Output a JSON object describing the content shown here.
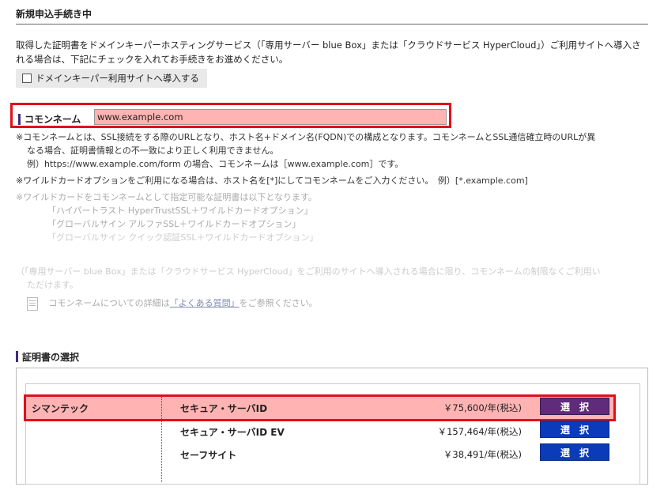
{
  "header": {
    "title": "新規申込手続き中"
  },
  "intro": {
    "text": "取得した証明書をドメインキーパーホスティングサービス（「専用サーバー blue Box」または「クラウドサービス HyperCloud」）ご利用サイトへ導入される場合は、下記にチェックを入れてお手続きをお進めください。"
  },
  "install_checkbox": {
    "label": "ドメインキーパー利用サイトへ導入する",
    "checked": false
  },
  "common_name": {
    "label": "コモンネーム",
    "value": "www.example.com"
  },
  "notes": {
    "n1_line1": "※コモンネームとは、SSL接続をする際のURLとなり、ホスト名+ドメイン名(FQDN)での構成となります。コモンネームとSSL通信確立時のURLが異",
    "n1_line2": "なる場合、証明書情報との不一致により正しく利用できません。",
    "n1_example": "例）https://www.example.com/form の場合、コモンネームは［www.example.com］です。",
    "n2": "※ワイルドカードオプションをご利用になる場合は、ホスト名を[*]にしてコモンネームをご入力ください。　例）[*.example.com]",
    "n3": "※ワイルドカードをコモンネームとして指定可能な証明書は以下となります。",
    "n3_items": [
      "「ハイパートラスト HyperTrustSSL＋ワイルドカードオプション」",
      "「グローバルサイン アルファSSL＋ワイルドカードオプション」",
      "「グローバルサイン クイック認証SSL＋ワイルドカードオプション」"
    ],
    "n4_line1": "（「専用サーバー blue Box」または「クラウドサービス HyperCloud」をご利用のサイトへ導入される場合に限り、コモンネームの制限なくご利用い",
    "n4_line2": "ただけます。",
    "help_prefix": "コモンネームについての詳細は",
    "help_link": "「よくある質問」",
    "help_suffix": "をご参照ください。"
  },
  "cert_section": {
    "title": "証明書の選択",
    "vendor": "シマンテック",
    "select_label": "選　択",
    "products": [
      {
        "name": "セキュア・サーバID",
        "price": "￥75,600/年(税込)"
      },
      {
        "name": "セキュア・サーバID EV",
        "price": "￥157,464/年(税込)"
      },
      {
        "name": "セーフサイト",
        "price": "￥38,491/年(税込)"
      }
    ]
  },
  "colors": {
    "highlight_border": "#e0101a",
    "highlight_fill": "#ffb3b3",
    "select_blue": "#0b3bb8",
    "select_active": "#5f2b7b",
    "accent_bar": "#3f2d7d"
  }
}
